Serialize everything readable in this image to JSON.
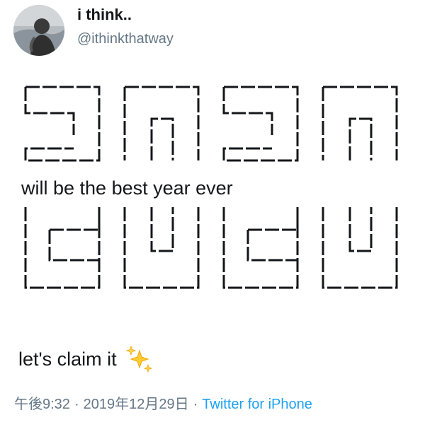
{
  "tweet": {
    "display_name": "i think..",
    "handle": "@ithinkthatway",
    "avatar_icon": "profile-photo",
    "art_line": "will be the best year ever",
    "body_text": "let's claim it",
    "emoji_icon": "sparkles-icon",
    "time": "午後9:32",
    "date": "2019年12月29日",
    "separator": "·",
    "source": "Twitter for iPhone",
    "source_color": "#1da1f2",
    "muted_color": "#657786"
  }
}
